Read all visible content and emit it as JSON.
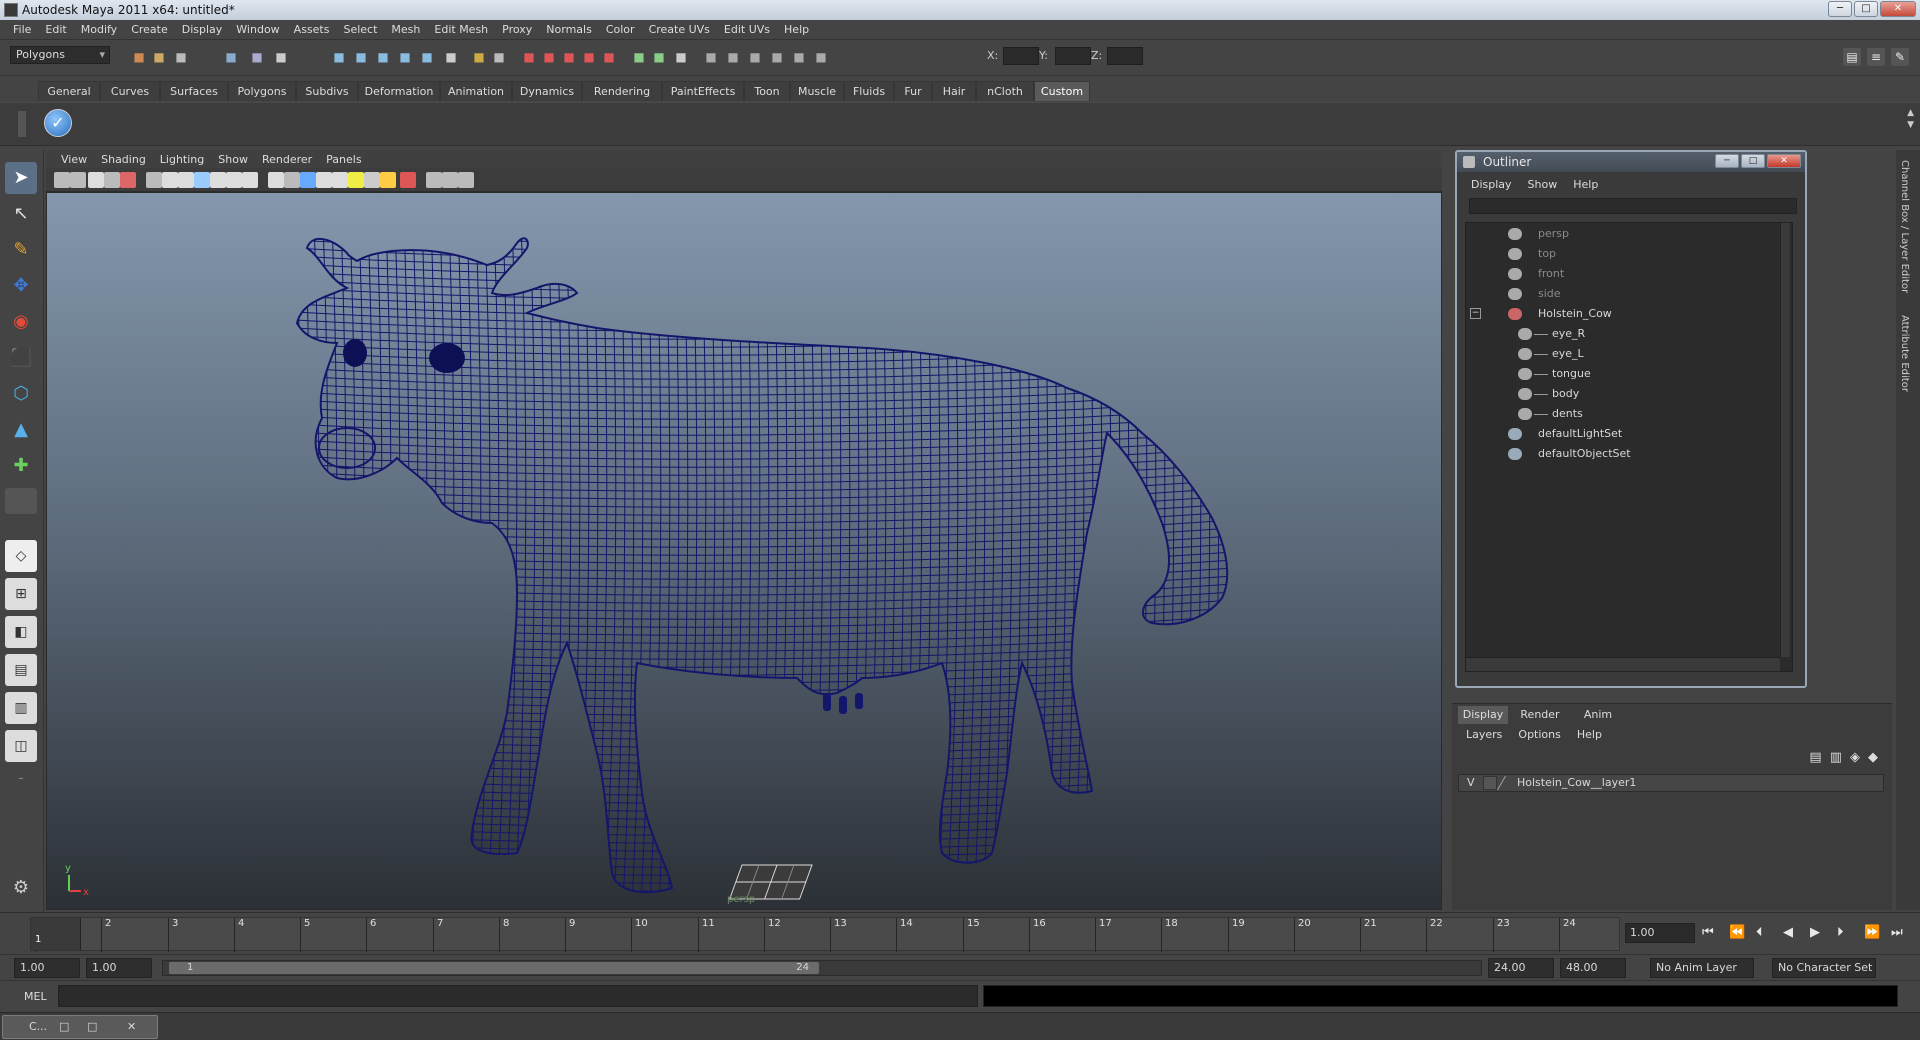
{
  "window": {
    "title": "Autodesk Maya 2011 x64: untitled*",
    "min": "─",
    "max": "□",
    "close": "✕"
  },
  "menubar": [
    "File",
    "Edit",
    "Modify",
    "Create",
    "Display",
    "Window",
    "Assets",
    "Select",
    "Mesh",
    "Edit Mesh",
    "Proxy",
    "Normals",
    "Color",
    "Create UVs",
    "Edit UVs",
    "Help"
  ],
  "status": {
    "mode": "Polygons",
    "x_label": "X:",
    "y_label": "Y:",
    "z_label": "Z:"
  },
  "shelf_tabs": [
    "General",
    "Curves",
    "Surfaces",
    "Polygons",
    "Subdivs",
    "Deformation",
    "Animation",
    "Dynamics",
    "Rendering",
    "PaintEffects",
    "Toon",
    "Muscle",
    "Fluids",
    "Fur",
    "Hair",
    "nCloth",
    "Custom"
  ],
  "shelf_active": "Custom",
  "viewport": {
    "menus": [
      "View",
      "Shading",
      "Lighting",
      "Show",
      "Renderer",
      "Panels"
    ],
    "camera": "persp",
    "axis_y": "y",
    "axis_x": "x",
    "wire_color": "#14166b"
  },
  "outliner": {
    "title": "Outliner",
    "menus": [
      "Display",
      "Show",
      "Help"
    ],
    "items": [
      {
        "label": "persp",
        "grey": true,
        "depth": 0
      },
      {
        "label": "top",
        "grey": true,
        "depth": 0
      },
      {
        "label": "front",
        "grey": true,
        "depth": 0
      },
      {
        "label": "side",
        "grey": true,
        "depth": 0
      },
      {
        "label": "Holstein_Cow",
        "grey": false,
        "depth": 0,
        "expanded": true
      },
      {
        "label": "eye_R",
        "grey": false,
        "depth": 1
      },
      {
        "label": "eye_L",
        "grey": false,
        "depth": 1
      },
      {
        "label": "tongue",
        "grey": false,
        "depth": 1
      },
      {
        "label": "body",
        "grey": false,
        "depth": 1
      },
      {
        "label": "dents",
        "grey": false,
        "depth": 1
      },
      {
        "label": "defaultLightSet",
        "grey": false,
        "depth": 0
      },
      {
        "label": "defaultObjectSet",
        "grey": false,
        "depth": 0
      }
    ],
    "expander": "−"
  },
  "layer_editor": {
    "tabs": [
      "Display",
      "Render",
      "Anim"
    ],
    "menus": [
      "Layers",
      "Options",
      "Help"
    ],
    "layer": {
      "visibility": "V",
      "name": "Holstein_Cow__layer1"
    }
  },
  "side_tabs": [
    "Channel Box / Layer Editor",
    "Attribute Editor"
  ],
  "timeline": {
    "ticks": [
      "1",
      "2",
      "3",
      "4",
      "5",
      "6",
      "7",
      "8",
      "9",
      "10",
      "11",
      "12",
      "13",
      "14",
      "15",
      "16",
      "17",
      "18",
      "19",
      "20",
      "21",
      "22",
      "23",
      "24"
    ],
    "current_frame": "1.00",
    "playhead": "1"
  },
  "playback": [
    "⏮",
    "⏪",
    "⏴",
    "◀",
    "▶",
    "⏵",
    "⏩",
    "⏭"
  ],
  "range": {
    "start": "1.00",
    "anim_start": "1.00",
    "handle_start": "1",
    "handle_end": "24",
    "end": "24.00",
    "anim_end": "48.00",
    "anim_layer": "No Anim Layer",
    "char_set": "No Character Set"
  },
  "cmdline": {
    "label": "MEL"
  },
  "taskbar": {
    "label": "C..."
  }
}
